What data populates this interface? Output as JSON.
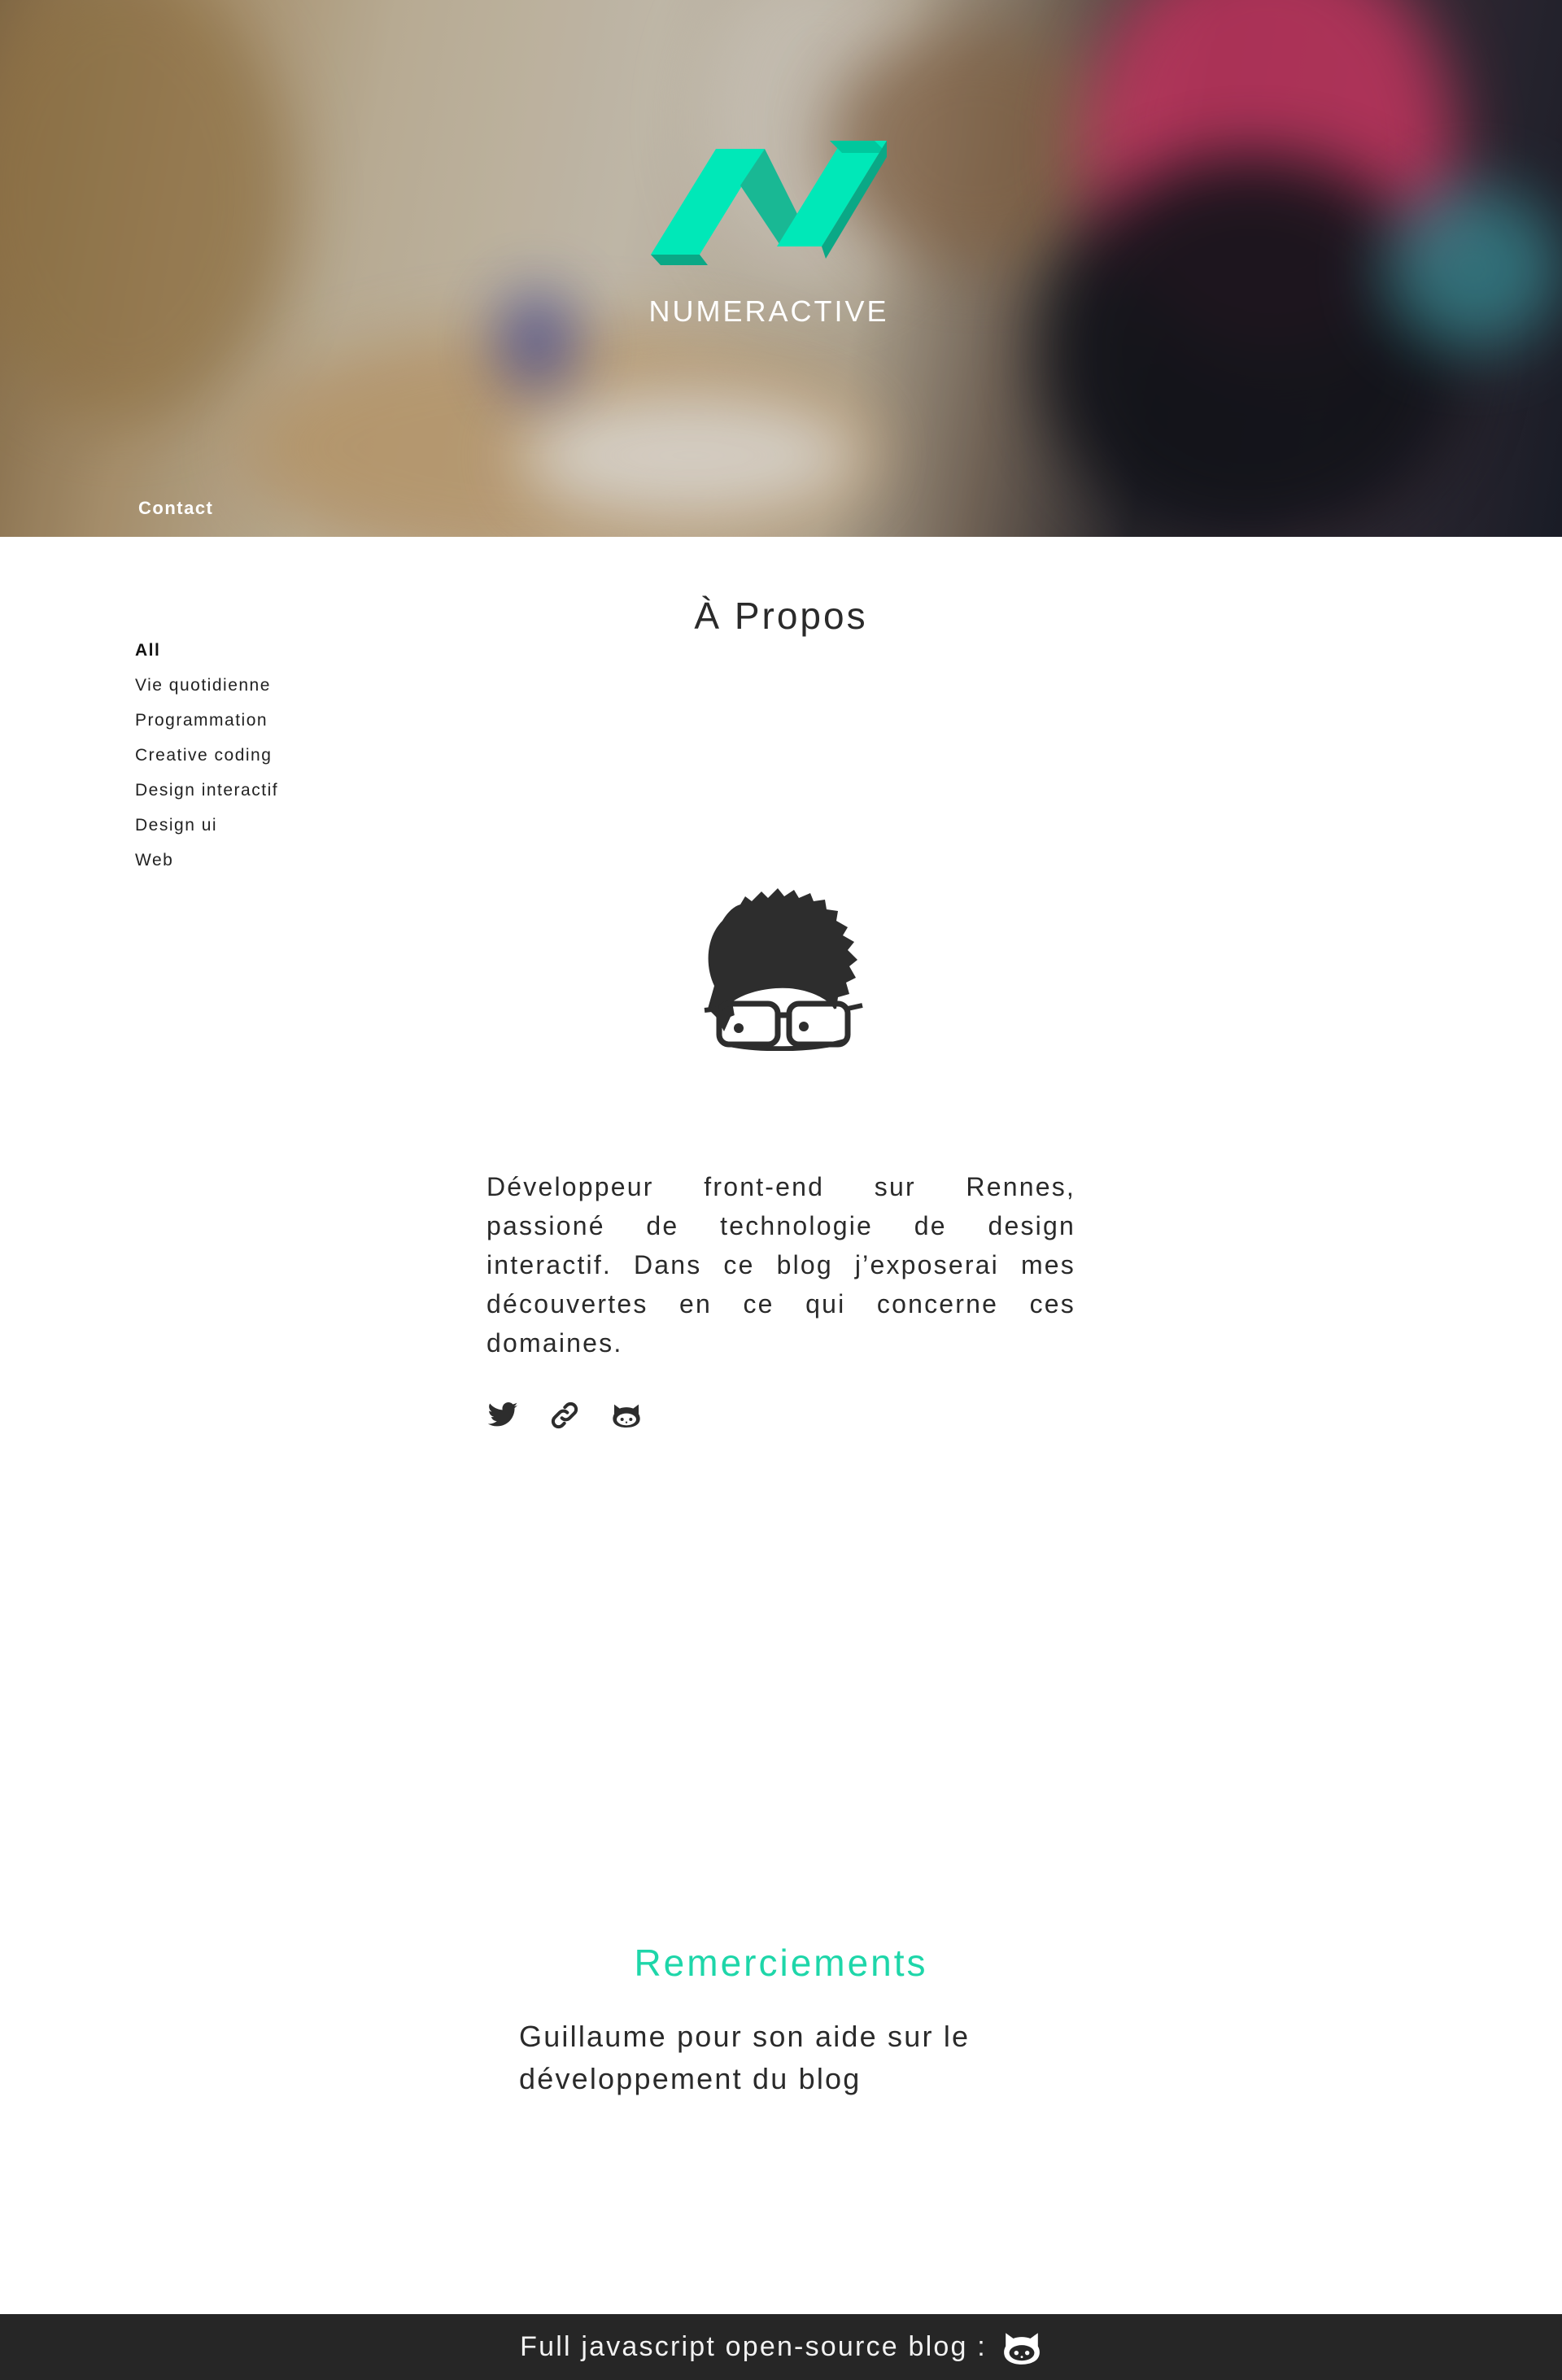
{
  "header": {
    "brand": "NUMERACTIVE",
    "logo_icon": "numeractive-logo-icon",
    "contact_label": "Contact",
    "accent_color": "#00e8b8"
  },
  "sidebar": {
    "items": [
      {
        "label": "All",
        "active": true
      },
      {
        "label": "Vie quotidienne"
      },
      {
        "label": "Programmation"
      },
      {
        "label": "Creative coding"
      },
      {
        "label": "Design interactif"
      },
      {
        "label": "Design ui"
      },
      {
        "label": "Web"
      }
    ]
  },
  "main": {
    "title": "À Propos",
    "avatar_icon": "avatar-glasses-icon",
    "bio": "Développeur front-end sur Rennes, passioné de technologie de design interactif. Dans ce blog j’exposerai mes découvertes en ce qui concerne ces domaines.",
    "social": [
      {
        "icon": "twitter-icon"
      },
      {
        "icon": "link-icon"
      },
      {
        "icon": "github-icon"
      }
    ],
    "thanks_title": "Remerciements",
    "thanks_text": "Guillaume pour son aide sur le développement du blog",
    "thanks_color": "#1ed6a9"
  },
  "footer": {
    "text": "Full javascript open-source blog :",
    "icon": "github-icon",
    "background": "#262626"
  }
}
